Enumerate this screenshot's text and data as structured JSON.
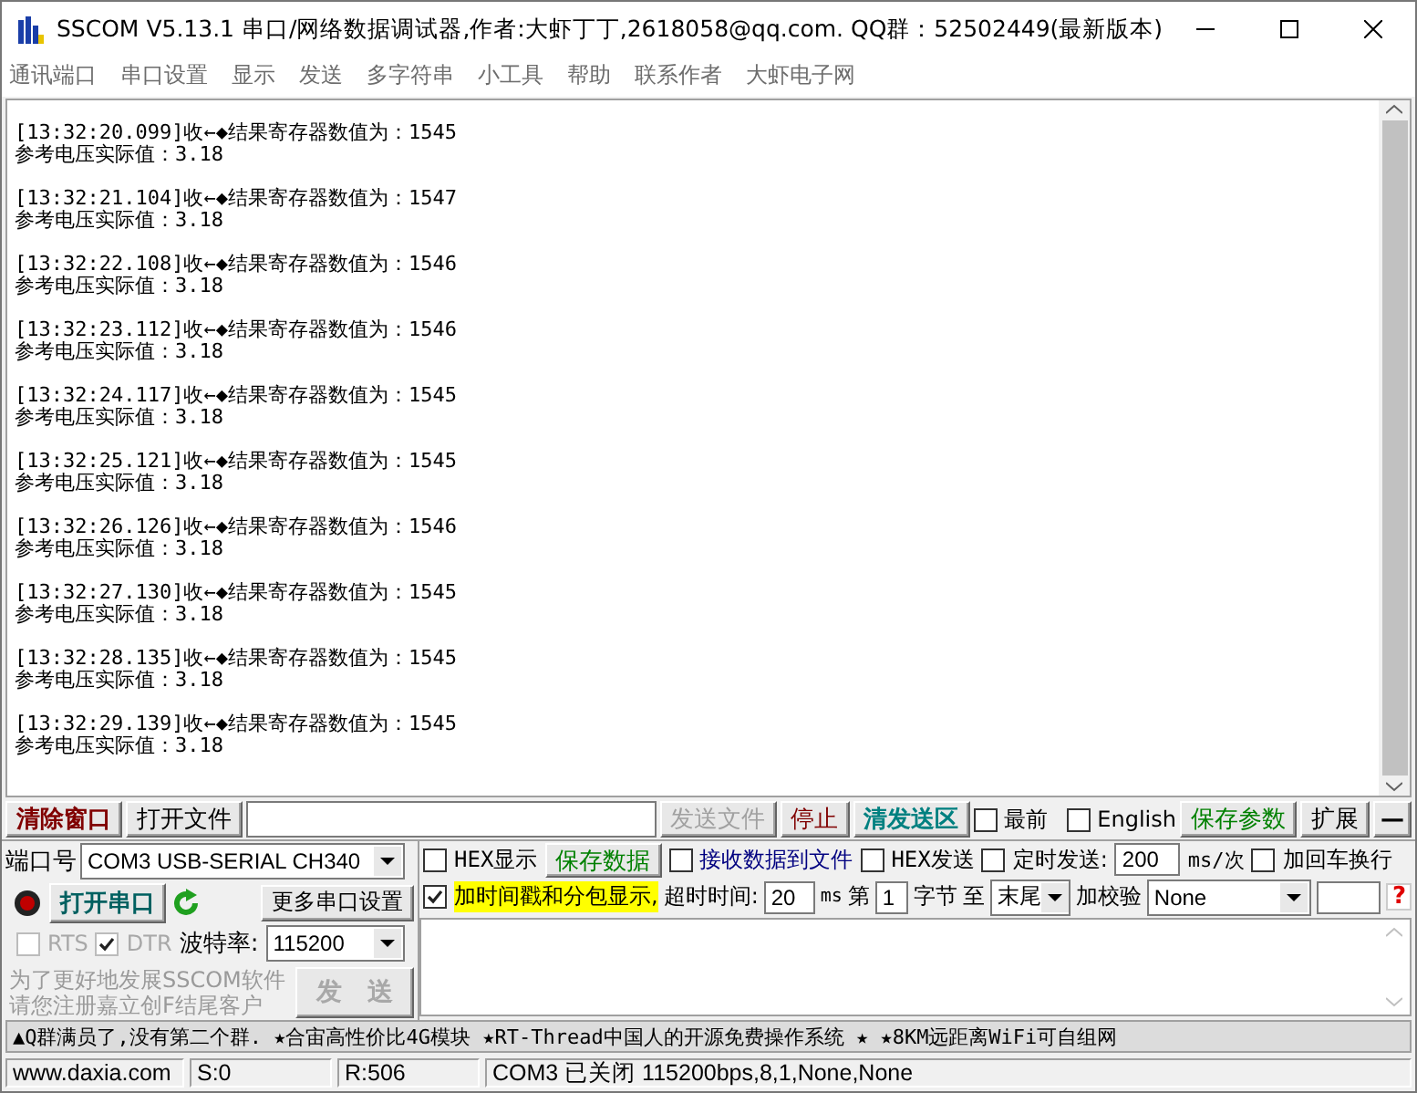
{
  "window": {
    "title": "SSCOM V5.13.1 串口/网络数据调试器,作者:大虾丁丁,2618058@qq.com. QQ群：52502449(最新版本)"
  },
  "menu": [
    "通讯端口",
    "串口设置",
    "显示",
    "发送",
    "多字符串",
    "小工具",
    "帮助",
    "联系作者",
    "大虾电子网"
  ],
  "log": [
    {
      "received": "[13:32:20.099]收←◆结果寄存器数值为：1545",
      "reference": "参考电压实际值：3.18"
    },
    {
      "received": "[13:32:21.104]收←◆结果寄存器数值为：1547",
      "reference": "参考电压实际值：3.18"
    },
    {
      "received": "[13:32:22.108]收←◆结果寄存器数值为：1546",
      "reference": "参考电压实际值：3.18"
    },
    {
      "received": "[13:32:23.112]收←◆结果寄存器数值为：1546",
      "reference": "参考电压实际值：3.18"
    },
    {
      "received": "[13:32:24.117]收←◆结果寄存器数值为：1545",
      "reference": "参考电压实际值：3.18"
    },
    {
      "received": "[13:32:25.121]收←◆结果寄存器数值为：1545",
      "reference": "参考电压实际值：3.18"
    },
    {
      "received": "[13:32:26.126]收←◆结果寄存器数值为：1546",
      "reference": "参考电压实际值：3.18"
    },
    {
      "received": "[13:32:27.130]收←◆结果寄存器数值为：1545",
      "reference": "参考电压实际值：3.18"
    },
    {
      "received": "[13:32:28.135]收←◆结果寄存器数值为：1545",
      "reference": "参考电压实际值：3.18"
    },
    {
      "received": "[13:32:29.139]收←◆结果寄存器数值为：1545",
      "reference": "参考电压实际值：3.18"
    }
  ],
  "toolbar": {
    "clear": "清除窗口",
    "open_file": "打开文件",
    "send_file": {
      "label": "发送文件",
      "disabled": true
    },
    "stop": "停止",
    "clear_send": "清发送区",
    "topmost": {
      "label": "最前",
      "checked": false
    },
    "english": {
      "label": "English",
      "checked": false
    },
    "save_params": "保存参数",
    "expand": "扩展",
    "collapse": "—"
  },
  "port": {
    "label": "端口号",
    "value": "COM3 USB-SERIAL CH340",
    "open": false,
    "open_button": "打开串口",
    "more_settings": "更多串口设置",
    "rts": {
      "label": "RTS",
      "checked": false,
      "disabled": true
    },
    "dtr": {
      "label": "DTR",
      "checked": true,
      "disabled": true
    },
    "baud_label": "波特率:",
    "baud": "115200"
  },
  "promo": [
    "为了更好地发展SSCOM软件",
    "请您注册嘉立创F结尾客户"
  ],
  "send_button": {
    "label": "发　送",
    "disabled": true
  },
  "options": {
    "hex_display": {
      "label": "HEX显示",
      "checked": false
    },
    "save_data": "保存数据",
    "recv_to_file": {
      "label": "接收数据到文件",
      "checked": false
    },
    "hex_send": {
      "label": "HEX发送",
      "checked": false
    },
    "timed_send": {
      "label": "定时发送:",
      "checked": false
    },
    "interval": "200",
    "interval_unit": "ms/次",
    "append_crlf": {
      "label": "加回车换行",
      "checked": false
    },
    "timestamp": {
      "label": "加时间戳和分包显示,",
      "checked": true
    },
    "timeout_label": "超时时间:",
    "timeout": "20",
    "timeout_unit": "ms",
    "byte_from_label": "第",
    "byte_from": "1",
    "byte_label": "字节",
    "to_label": "至",
    "byte_to": "末尾",
    "checksum_label": "加校验",
    "checksum": "None",
    "help": "?"
  },
  "marquee": "▲Q群满员了,没有第二个群. ★合宙高性价比4G模块 ★RT-Thread中国人的开源免费操作系统 ★ ★8KM远距离WiFi可自组网",
  "status_bar": [
    "www.daxia.com",
    "S:0",
    "R:506",
    "COM3 已关闭  115200bps,8,1,None,None"
  ]
}
